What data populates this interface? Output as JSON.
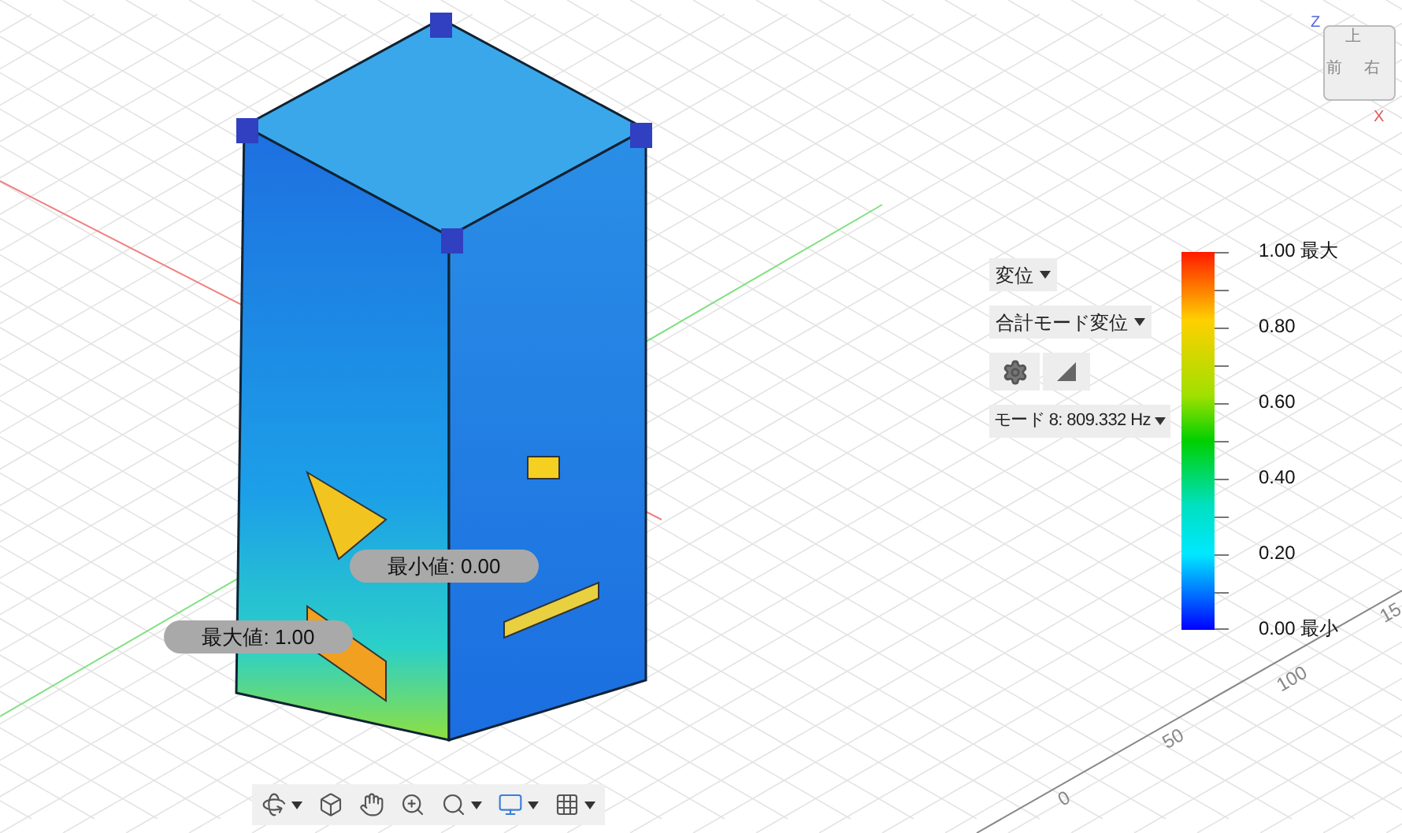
{
  "view_cube": {
    "faces": [
      {
        "kind": "top",
        "label": "上"
      },
      {
        "kind": "front",
        "label": "前"
      },
      {
        "kind": "right",
        "label": "右"
      }
    ],
    "axes": [
      {
        "kind": "z",
        "label": "Z"
      },
      {
        "kind": "x",
        "label": "X"
      }
    ]
  },
  "result_panel": {
    "result_type": "変位",
    "component": "合計モード変位",
    "mode": "モード 8: 809.332 Hz"
  },
  "legend": {
    "labels": [
      "1.00 最大",
      "0.80",
      "0.60",
      "0.40",
      "0.20",
      "0.00 最小"
    ]
  },
  "probes": [
    {
      "label": "最小値: 0.00"
    },
    {
      "label": "最大値: 1.00"
    }
  ],
  "ruler_labels": [
    "0",
    "50",
    "100",
    "15"
  ],
  "toolbar": [
    {
      "kind": "orbit",
      "dropdown": true
    },
    {
      "kind": "look",
      "dropdown": false
    },
    {
      "kind": "pan",
      "dropdown": false
    },
    {
      "kind": "zoom",
      "dropdown": false
    },
    {
      "kind": "zoom-window",
      "dropdown": true
    },
    {
      "kind": "display",
      "dropdown": true
    },
    {
      "kind": "grid",
      "dropdown": true
    }
  ]
}
